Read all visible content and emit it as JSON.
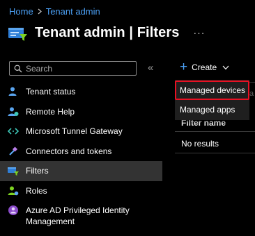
{
  "breadcrumb": {
    "items": [
      "Home",
      "Tenant admin"
    ]
  },
  "title": {
    "text": "Tenant admin | Filters",
    "more": "···"
  },
  "search": {
    "placeholder": "Search"
  },
  "sidebar": {
    "collapse": "«",
    "items": [
      {
        "label": "Tenant status",
        "icon": "person-icon"
      },
      {
        "label": "Remote Help",
        "icon": "person-help-icon"
      },
      {
        "label": "Microsoft Tunnel Gateway",
        "icon": "code-arrows-icon"
      },
      {
        "label": "Connectors and tokens",
        "icon": "plug-icon"
      },
      {
        "label": "Filters",
        "icon": "filter-icon",
        "active": true
      },
      {
        "label": "Roles",
        "icon": "roles-icon"
      },
      {
        "label": "Azure AD Privileged Identity Management",
        "icon": "pim-icon"
      }
    ]
  },
  "toolbar": {
    "create_label": "Create"
  },
  "create_menu": {
    "items": [
      "Managed devices",
      "Managed apps"
    ]
  },
  "table": {
    "partial_text": "a",
    "column_header": "Filter name",
    "empty_text": "No results"
  },
  "colors": {
    "accent": "#4ba0f5",
    "highlight_border": "#e81123",
    "active_nav": "#333333"
  }
}
